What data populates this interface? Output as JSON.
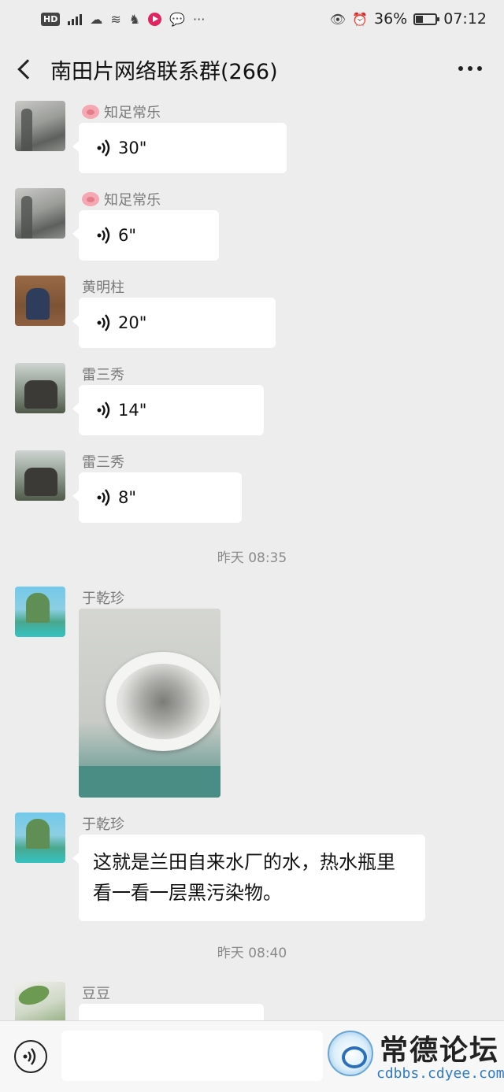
{
  "status_bar": {
    "hd": "HD",
    "network": "4G",
    "battery_percent": "36%",
    "time": "07:12"
  },
  "header": {
    "title": "南田片网络联系群(266)"
  },
  "messages": [
    {
      "type": "voice",
      "sender": "知足常乐",
      "duration": "30\""
    },
    {
      "type": "voice",
      "sender": "知足常乐",
      "duration": "6\""
    },
    {
      "type": "voice",
      "sender": "黄明柱",
      "duration": "20\""
    },
    {
      "type": "voice",
      "sender": "雷三秀",
      "duration": "14\""
    },
    {
      "type": "voice",
      "sender": "雷三秀",
      "duration": "8\""
    },
    {
      "type": "timestamp",
      "text": "昨天 08:35"
    },
    {
      "type": "image",
      "sender": "于乾珍"
    },
    {
      "type": "text",
      "sender": "于乾珍",
      "text": "这就是兰田自来水厂的水，热水瓶里看一看一层黑污染物。"
    },
    {
      "type": "timestamp",
      "text": "昨天 08:40"
    },
    {
      "type": "voice",
      "sender": "豆豆",
      "duration": ""
    }
  ],
  "watermark": {
    "title": "常德论坛",
    "url": "cdbbs.cdyee.com"
  }
}
